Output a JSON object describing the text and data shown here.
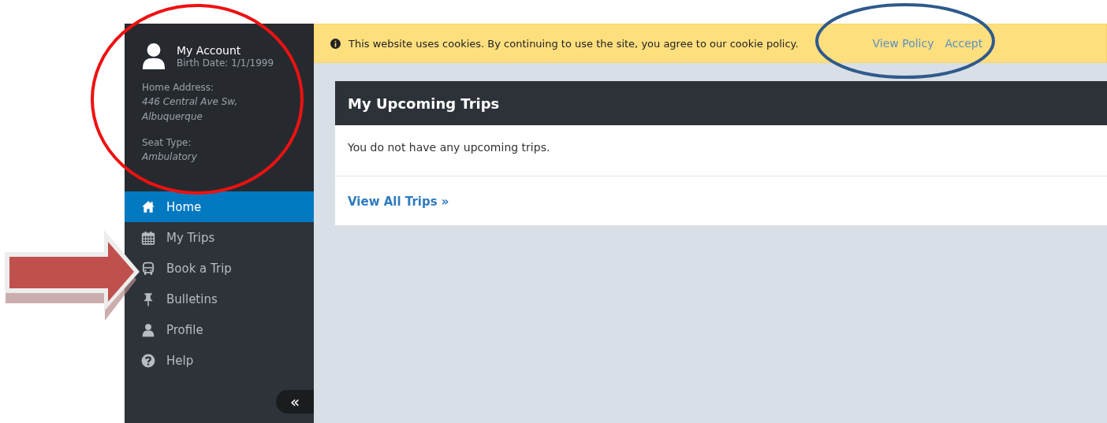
{
  "account": {
    "name": "My Account",
    "birth_date": "Birth Date: 1/1/1999",
    "fields": [
      {
        "label": "Home Address:",
        "value": "446 Central Ave Sw, Albuquerque"
      },
      {
        "label": "Seat Type:",
        "value": "Ambulatory"
      }
    ]
  },
  "nav": [
    {
      "label": "Home",
      "kind": "home",
      "selected": true
    },
    {
      "label": "My Trips",
      "kind": "calendar",
      "selected": false
    },
    {
      "label": "Book a Trip",
      "kind": "bus",
      "selected": false
    },
    {
      "label": "Bulletins",
      "kind": "pin",
      "selected": false
    },
    {
      "label": "Profile",
      "kind": "user",
      "selected": false
    },
    {
      "label": "Help",
      "kind": "help",
      "selected": false
    }
  ],
  "collapse_button": "«",
  "cookie_bar": {
    "message": "This website uses cookies. By continuing to use the site, you agree to our cookie policy.",
    "links": [
      "View Policy",
      "Accept"
    ]
  },
  "card": {
    "title": "My Upcoming Trips",
    "message": "You do not have any upcoming trips.",
    "link": "View All Trips »"
  }
}
